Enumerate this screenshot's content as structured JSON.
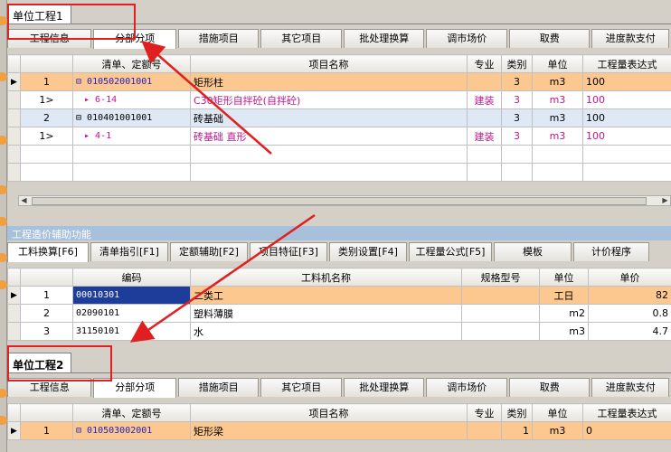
{
  "project1": {
    "doc_tab": "单位工程1",
    "tabs": [
      "工程信息",
      "分部分项",
      "措施项目",
      "其它项目",
      "批处理换算",
      "调市场价",
      "取费",
      "进度款支付"
    ],
    "active_tab": 1,
    "columns": [
      "",
      "",
      "清单、定额号",
      "项目名称",
      "专业",
      "类别",
      "单位",
      "工程量表达式"
    ],
    "rows": [
      {
        "indicator": "▶",
        "num": "1",
        "code": "010502001001",
        "name": "矩形柱",
        "major": "",
        "type": "3",
        "unit": "m3",
        "qty": "100"
      },
      {
        "indicator": "",
        "num": "1>",
        "code": "6-14",
        "name": "C30矩形自拌砼(自拌砼)",
        "major": "建装",
        "type": "3",
        "unit": "m3",
        "qty": "100"
      },
      {
        "indicator": "",
        "num": "2",
        "code": "010401001001",
        "name": "砖基础",
        "major": "",
        "type": "3",
        "unit": "m3",
        "qty": "100"
      },
      {
        "indicator": "",
        "num": "1>",
        "code": "4-1",
        "name": "砖基础 直形",
        "major": "建装",
        "type": "3",
        "unit": "m3",
        "qty": "100"
      }
    ]
  },
  "aux": {
    "title": "工程造价辅助功能",
    "tabs": [
      "工料换算[F6]",
      "清单指引[F1]",
      "定额辅助[F2]",
      "项目特征[F3]",
      "类别设置[F4]",
      "工程量公式[F5]",
      "模板",
      "计价程序"
    ],
    "active_tab": 0,
    "columns": [
      "",
      "",
      "编码",
      "工料机名称",
      "规格型号",
      "单位",
      "单价"
    ],
    "rows": [
      {
        "indicator": "▶",
        "num": "1",
        "code": "00010301",
        "name": "二类工",
        "spec": "",
        "unit": "工日",
        "price": "82"
      },
      {
        "indicator": "",
        "num": "2",
        "code": "02090101",
        "name": "塑料薄膜",
        "spec": "",
        "unit": "m2",
        "price": "0.8"
      },
      {
        "indicator": "",
        "num": "3",
        "code": "31150101",
        "name": "水",
        "spec": "",
        "unit": "m3",
        "price": "4.7"
      }
    ]
  },
  "project2": {
    "doc_tab": "单位工程2",
    "tabs": [
      "工程信息",
      "分部分项",
      "措施项目",
      "其它项目",
      "批处理换算",
      "调市场价",
      "取费",
      "进度款支付"
    ],
    "active_tab": 1,
    "columns": [
      "",
      "",
      "清单、定额号",
      "项目名称",
      "专业",
      "类别",
      "单位",
      "工程量表达式"
    ],
    "rows": [
      {
        "indicator": "▶",
        "num": "1",
        "code": "010503002001",
        "name": "矩形梁",
        "major": "",
        "type": "1",
        "unit": "m3",
        "qty": "0"
      }
    ]
  },
  "colors": {
    "annotation": "#e02020",
    "selected_row": "#fdc890",
    "code_blue": "#2020c0",
    "sub_magenta": "#c0168e",
    "aux_header": "#a7c0dc"
  }
}
